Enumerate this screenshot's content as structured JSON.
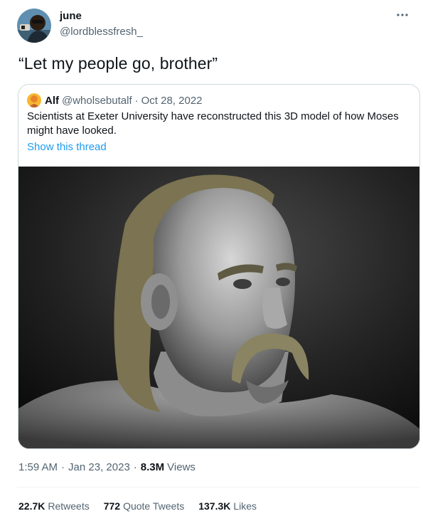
{
  "author": {
    "name": "june",
    "handle": "@lordblessfresh_"
  },
  "tweet": {
    "text": "“Let my people go, brother”"
  },
  "quoted": {
    "name": "Alf",
    "handle": "@wholsebutalf",
    "separator": "·",
    "date": "Oct 28, 2022",
    "text": "Scientists at Exeter University have reconstructed this 3D model of how Moses might have looked.",
    "show_thread": "Show this thread",
    "media_icon": "3d-sculpt-head-image"
  },
  "meta": {
    "time": "1:59 AM",
    "separator": "·",
    "date": "Jan 23, 2023",
    "views_count": "8.3M",
    "views_label": "Views"
  },
  "stats": {
    "retweets_count": "22.7K",
    "retweets_label": "Retweets",
    "quotes_count": "772",
    "quotes_label": "Quote Tweets",
    "likes_count": "137.3K",
    "likes_label": "Likes"
  },
  "icons": {
    "more": "more-horizontal-icon",
    "avatar": "user-avatar",
    "quoted_avatar": "quoted-user-avatar"
  },
  "colors": {
    "link": "#1d9bf0",
    "text_primary": "#0f1419",
    "text_secondary": "#536471",
    "border": "#cfd9de"
  }
}
